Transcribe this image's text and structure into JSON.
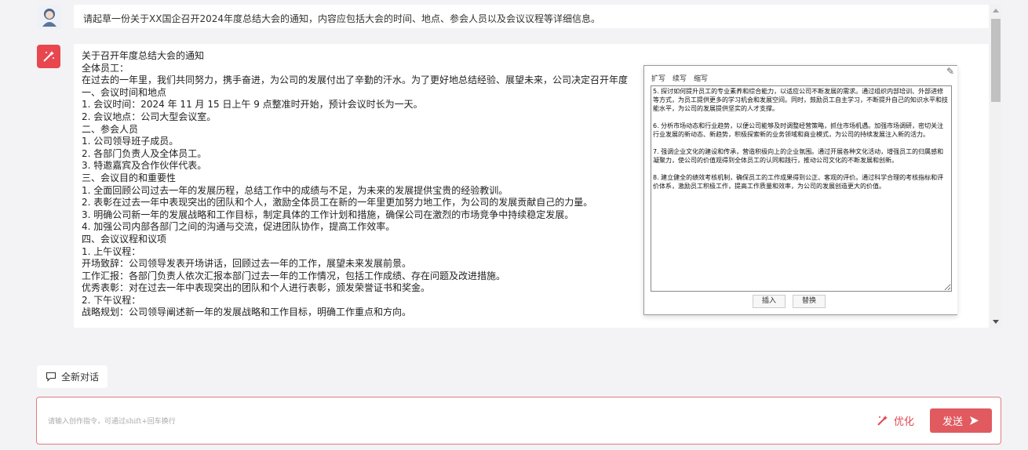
{
  "conversation": {
    "user_prompt": "请起草一份关于XX国企召开2024年度总结大会的通知，内容应包括大会的时间、地点、参会人员以及会议议程等详细信息。",
    "answer_lines": [
      "关于召开年度总结大会的通知",
      "全体员工：",
      "在过去的一年里，我们共同努力，携手奋进，为公司的发展付出了辛勤的汗水。为了更好地总结经验、展望未来，公司决定召开年度",
      "一、会议时间和地点",
      "1. 会议时间：2024 年 11 月 15 日上午 9 点整准时开始，预计会议时长为一天。",
      "2. 会议地点：公司大型会议室。",
      "二、参会人员",
      "1. 公司领导班子成员。",
      "2. 各部门负责人及全体员工。",
      "3. 特邀嘉宾及合作伙伴代表。",
      "三、会议目的和重要性",
      "1. 全面回顾公司过去一年的发展历程，总结工作中的成绩与不足，为未来的发展提供宝贵的经验教训。",
      "2. 表彰在过去一年中表现突出的团队和个人，激励全体员工在新的一年里更加努力地工作，为公司的发展贡献自己的力量。",
      "3. 明确公司新一年的发展战略和工作目标，制定具体的工作计划和措施，确保公司在激烈的市场竞争中持续稳定发展。",
      "4. 加强公司内部各部门之间的沟通与交流，促进团队协作，提高工作效率。",
      "四、会议议程和议项",
      "1. 上午议程：",
      "开场致辞：公司领导发表开场讲话，回顾过去一年的工作，展望未来发展前景。",
      "工作汇报：各部门负责人依次汇报本部门过去一年的工作情况，包括工作成绩、存在问题及改进措施。",
      "优秀表彰：对在过去一年中表现突出的团队和个人进行表彰，颁发荣誉证书和奖金。",
      "2. 下午议程：",
      "战略规划：公司领导阐述新一年的发展战略和工作目标，明确工作重点和方向。"
    ]
  },
  "popup": {
    "tabs": [
      "扩写",
      "续写",
      "缩写"
    ],
    "content": "5. 探讨如何提升员工的专业素养和综合能力，以适应公司不断发展的需求。通过组织内部培训、外部进修等方式，为员工提供更多的学习机会和发展空间。同时，鼓励员工自主学习，不断提升自己的知识水平和技能水平，为公司的发展提供坚实的人才支撑。\n\n6. 分析市场动态和行业趋势，以便公司能够及时调整经营策略，抓住市场机遇。加强市场调研，密切关注行业发展的新动态、新趋势，积极探索新的业务领域和商业模式，为公司的持续发展注入新的活力。\n\n7. 强调企业文化的建设和传承，营造积极向上的企业氛围。通过开展各种文化活动，增强员工的归属感和凝聚力，使公司的价值观得到全体员工的认同和践行，推动公司文化的不断发展和创新。\n\n8. 建立健全的绩效考核机制，确保员工的工作成果得到公正、客观的评价。通过科学合理的考核指标和评价体系，激励员工积极工作，提高工作质量和效率，为公司的发展创造更大的价值。",
    "insert_label": "插入",
    "replace_label": "替换"
  },
  "new_chat_label": "全新对话",
  "input": {
    "placeholder": "请输入创作指令，可通过shift+回车换行",
    "optimize_label": "优化",
    "send_label": "发送"
  },
  "colors": {
    "accent": "#e05a60",
    "border": "#e07b80"
  }
}
